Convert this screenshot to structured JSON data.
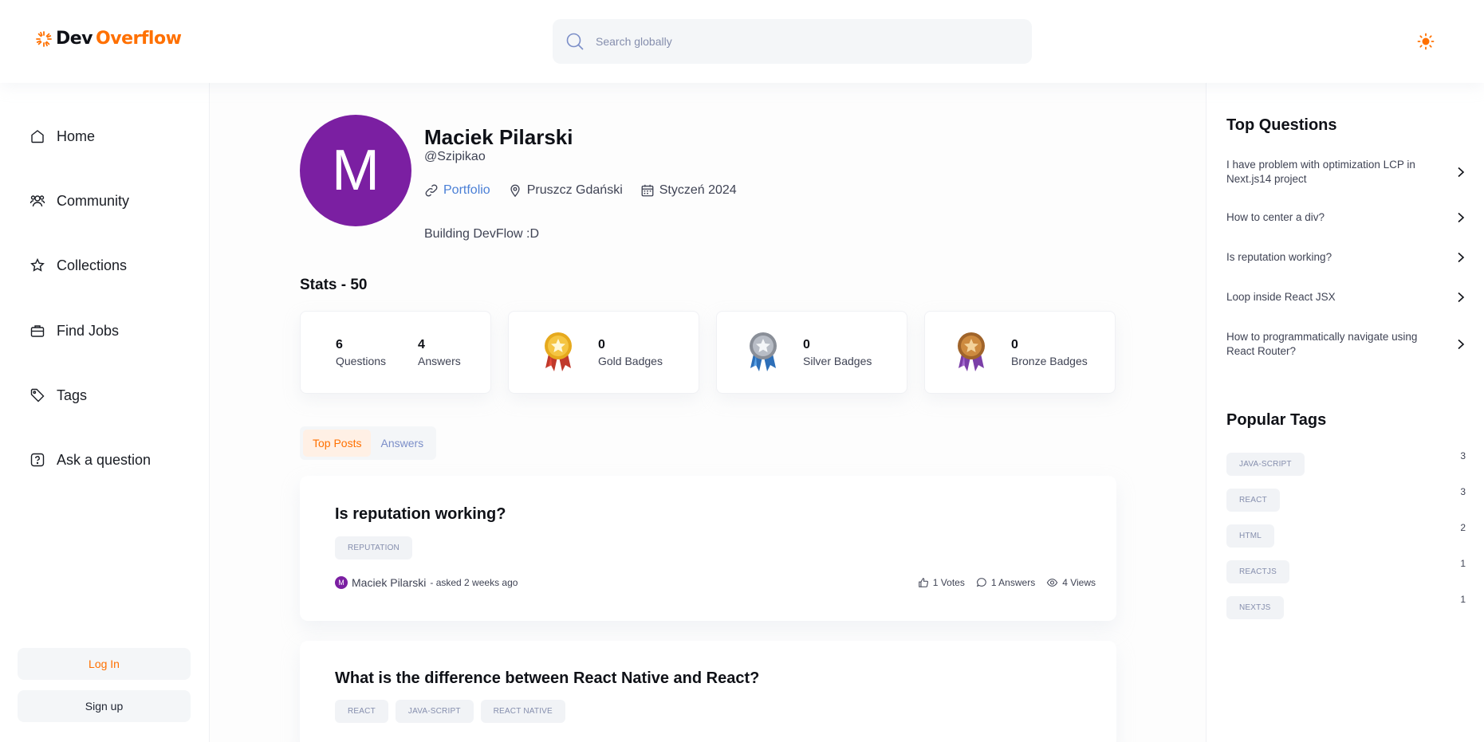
{
  "header": {
    "logo_part1": "Dev",
    "logo_part2": "Overflow",
    "search_placeholder": "Search globally",
    "theme_icon": "sun-icon"
  },
  "sidebar": {
    "items": [
      {
        "label": "Home",
        "icon": "home-icon"
      },
      {
        "label": "Community",
        "icon": "users-icon"
      },
      {
        "label": "Collections",
        "icon": "star-icon"
      },
      {
        "label": "Find Jobs",
        "icon": "briefcase-icon"
      },
      {
        "label": "Tags",
        "icon": "tag-icon"
      },
      {
        "label": "Ask a question",
        "icon": "question-icon"
      }
    ],
    "login_label": "Log In",
    "signup_label": "Sign up"
  },
  "profile": {
    "initial": "M",
    "name": "Maciek Pilarski",
    "username": "@Szipikao",
    "portfolio": "Portfolio",
    "location": "Pruszcz Gdański",
    "joined": "Styczeń 2024",
    "bio": "Building DevFlow :D"
  },
  "stats": {
    "title": "Stats - 50",
    "questions": {
      "value": "6",
      "label": "Questions"
    },
    "answers": {
      "value": "4",
      "label": "Answers"
    },
    "gold": {
      "value": "0",
      "label": "Gold Badges"
    },
    "silver": {
      "value": "0",
      "label": "Silver Badges"
    },
    "bronze": {
      "value": "0",
      "label": "Bronze Badges"
    }
  },
  "tabs": {
    "top_posts": "Top Posts",
    "answers": "Answers"
  },
  "posts": [
    {
      "title": "Is reputation working?",
      "tags": [
        "REPUTATION"
      ],
      "author": "Maciek Pilarski",
      "author_initial": "M",
      "asked": "- asked 2 weeks ago",
      "votes": "1 Votes",
      "answers": "1 Answers",
      "views": "4 Views"
    },
    {
      "title": "What is the difference between React Native and React?",
      "tags": [
        "REACT",
        "JAVA-SCRIPT",
        "REACT NATIVE"
      ]
    }
  ],
  "right": {
    "top_questions_title": "Top Questions",
    "top_questions": [
      "I have problem with optimization LCP in Next.js14 project",
      "How to center a div?",
      "Is reputation working?",
      "Loop inside React JSX",
      "How to programmatically navigate using React Router?"
    ],
    "popular_tags_title": "Popular Tags",
    "popular_tags": [
      {
        "name": "JAVA-SCRIPT",
        "count": "3"
      },
      {
        "name": "REACT",
        "count": "3"
      },
      {
        "name": "HTML",
        "count": "2"
      },
      {
        "name": "REACTJS",
        "count": "1"
      },
      {
        "name": "NEXTJS",
        "count": "1"
      }
    ]
  },
  "colors": {
    "accent": "#ff7000",
    "avatar": "#7b1fa2",
    "link": "#4a7fd6"
  }
}
